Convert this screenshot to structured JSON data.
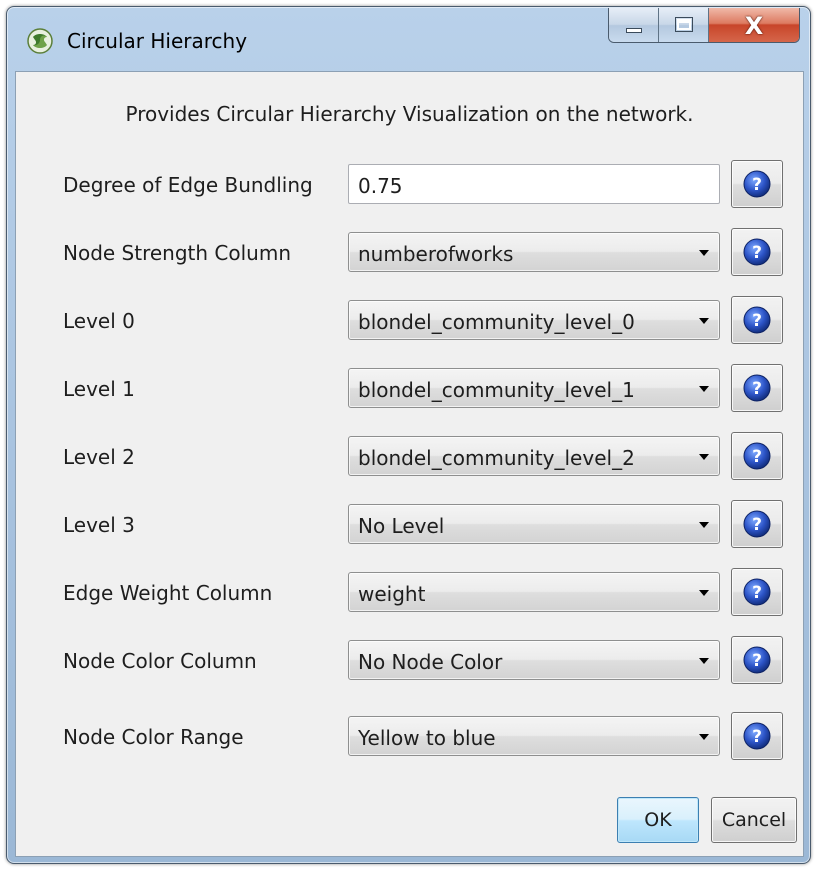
{
  "window": {
    "title": "Circular Hierarchy",
    "icon": "cytoscape-app-icon",
    "controls": {
      "minimize": "minimize-icon",
      "maximize": "maximize-icon",
      "close_glyph": "X"
    }
  },
  "description": "Provides Circular Hierarchy Visualization on the network.",
  "fields": [
    {
      "label": "Degree of Edge Bundling",
      "type": "text",
      "value": "0.75"
    },
    {
      "label": "Node Strength Column",
      "type": "select",
      "value": "numberofworks"
    },
    {
      "label": "Level 0",
      "type": "select",
      "value": "blondel_community_level_0"
    },
    {
      "label": "Level 1",
      "type": "select",
      "value": "blondel_community_level_1"
    },
    {
      "label": "Level 2",
      "type": "select",
      "value": "blondel_community_level_2"
    },
    {
      "label": "Level 3",
      "type": "select",
      "value": "No Level"
    },
    {
      "label": "Edge Weight Column",
      "type": "select",
      "value": "weight"
    },
    {
      "label": "Node Color Column",
      "type": "select",
      "value": "No Node Color"
    },
    {
      "label": "Node Color Range",
      "type": "select",
      "value": "Yellow to blue"
    }
  ],
  "help_icon": "help-icon",
  "buttons": {
    "ok": "OK",
    "cancel": "Cancel"
  },
  "colors": {
    "close_red": "#c8452a",
    "help_blue": "#2d55c8",
    "ok_border": "#3c7fb1"
  }
}
